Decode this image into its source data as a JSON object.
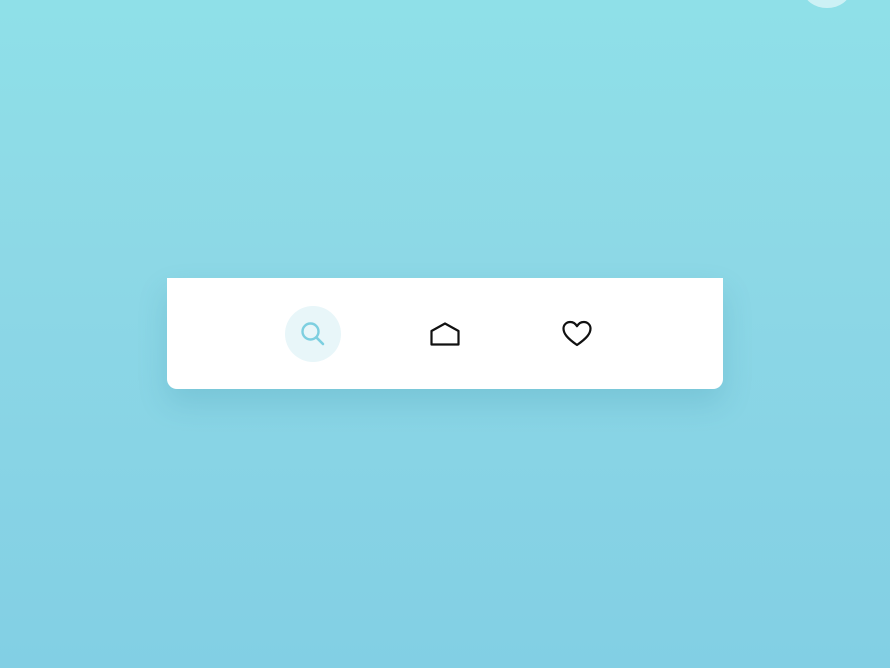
{
  "colors": {
    "background_top": "#8fe0e8",
    "background_bottom": "#82cfe4",
    "card": "#ffffff",
    "active_icon": "#7dcfe0",
    "active_bg": "#e8f6f9",
    "inactive_icon": "#111111"
  },
  "nav": {
    "items": [
      {
        "icon": "search-icon",
        "active": true
      },
      {
        "icon": "home-icon",
        "active": false
      },
      {
        "icon": "heart-icon",
        "active": false
      }
    ]
  }
}
